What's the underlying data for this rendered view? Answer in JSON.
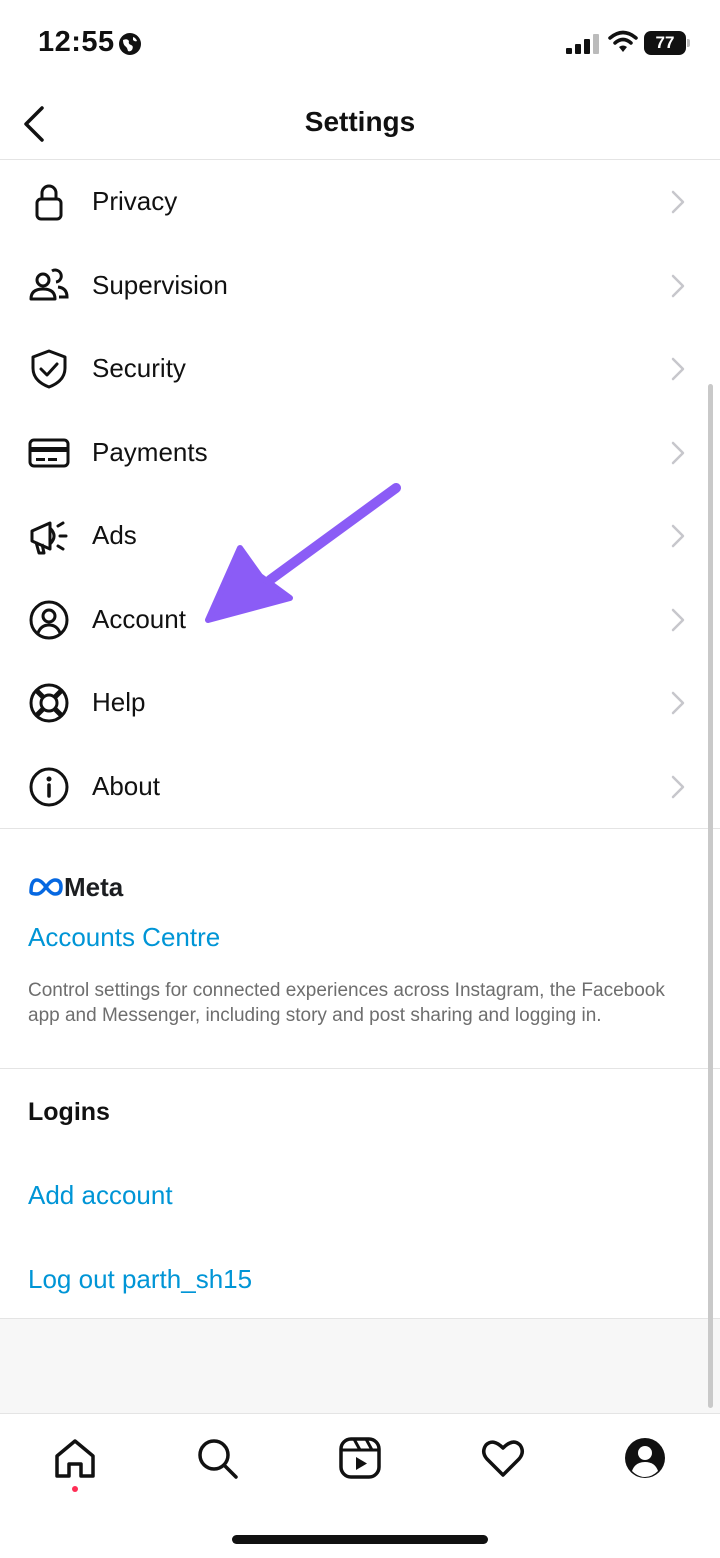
{
  "status_bar": {
    "time": "12:55",
    "battery": "77"
  },
  "nav": {
    "title": "Settings"
  },
  "menu": {
    "items": [
      {
        "label": "Privacy",
        "icon": "lock-icon"
      },
      {
        "label": "Supervision",
        "icon": "people-icon"
      },
      {
        "label": "Security",
        "icon": "shield-icon"
      },
      {
        "label": "Payments",
        "icon": "card-icon"
      },
      {
        "label": "Ads",
        "icon": "megaphone-icon"
      },
      {
        "label": "Account",
        "icon": "account-icon"
      },
      {
        "label": "Help",
        "icon": "lifebuoy-icon"
      },
      {
        "label": "About",
        "icon": "info-icon"
      }
    ]
  },
  "meta": {
    "brand": "Meta",
    "accounts_centre": "Accounts Centre",
    "description": "Control settings for connected experiences across Instagram, the Facebook app and Messenger, including story and post sharing and logging in."
  },
  "logins": {
    "heading": "Logins",
    "add_account": "Add account",
    "logout": "Log out parth_sh15"
  },
  "tabs": [
    "home-icon",
    "search-icon",
    "reels-icon",
    "heart-icon",
    "profile-icon"
  ],
  "colors": {
    "link": "#0095d6",
    "annotation_arrow": "#8b5cf6",
    "meta_blue": "#0668e1"
  }
}
